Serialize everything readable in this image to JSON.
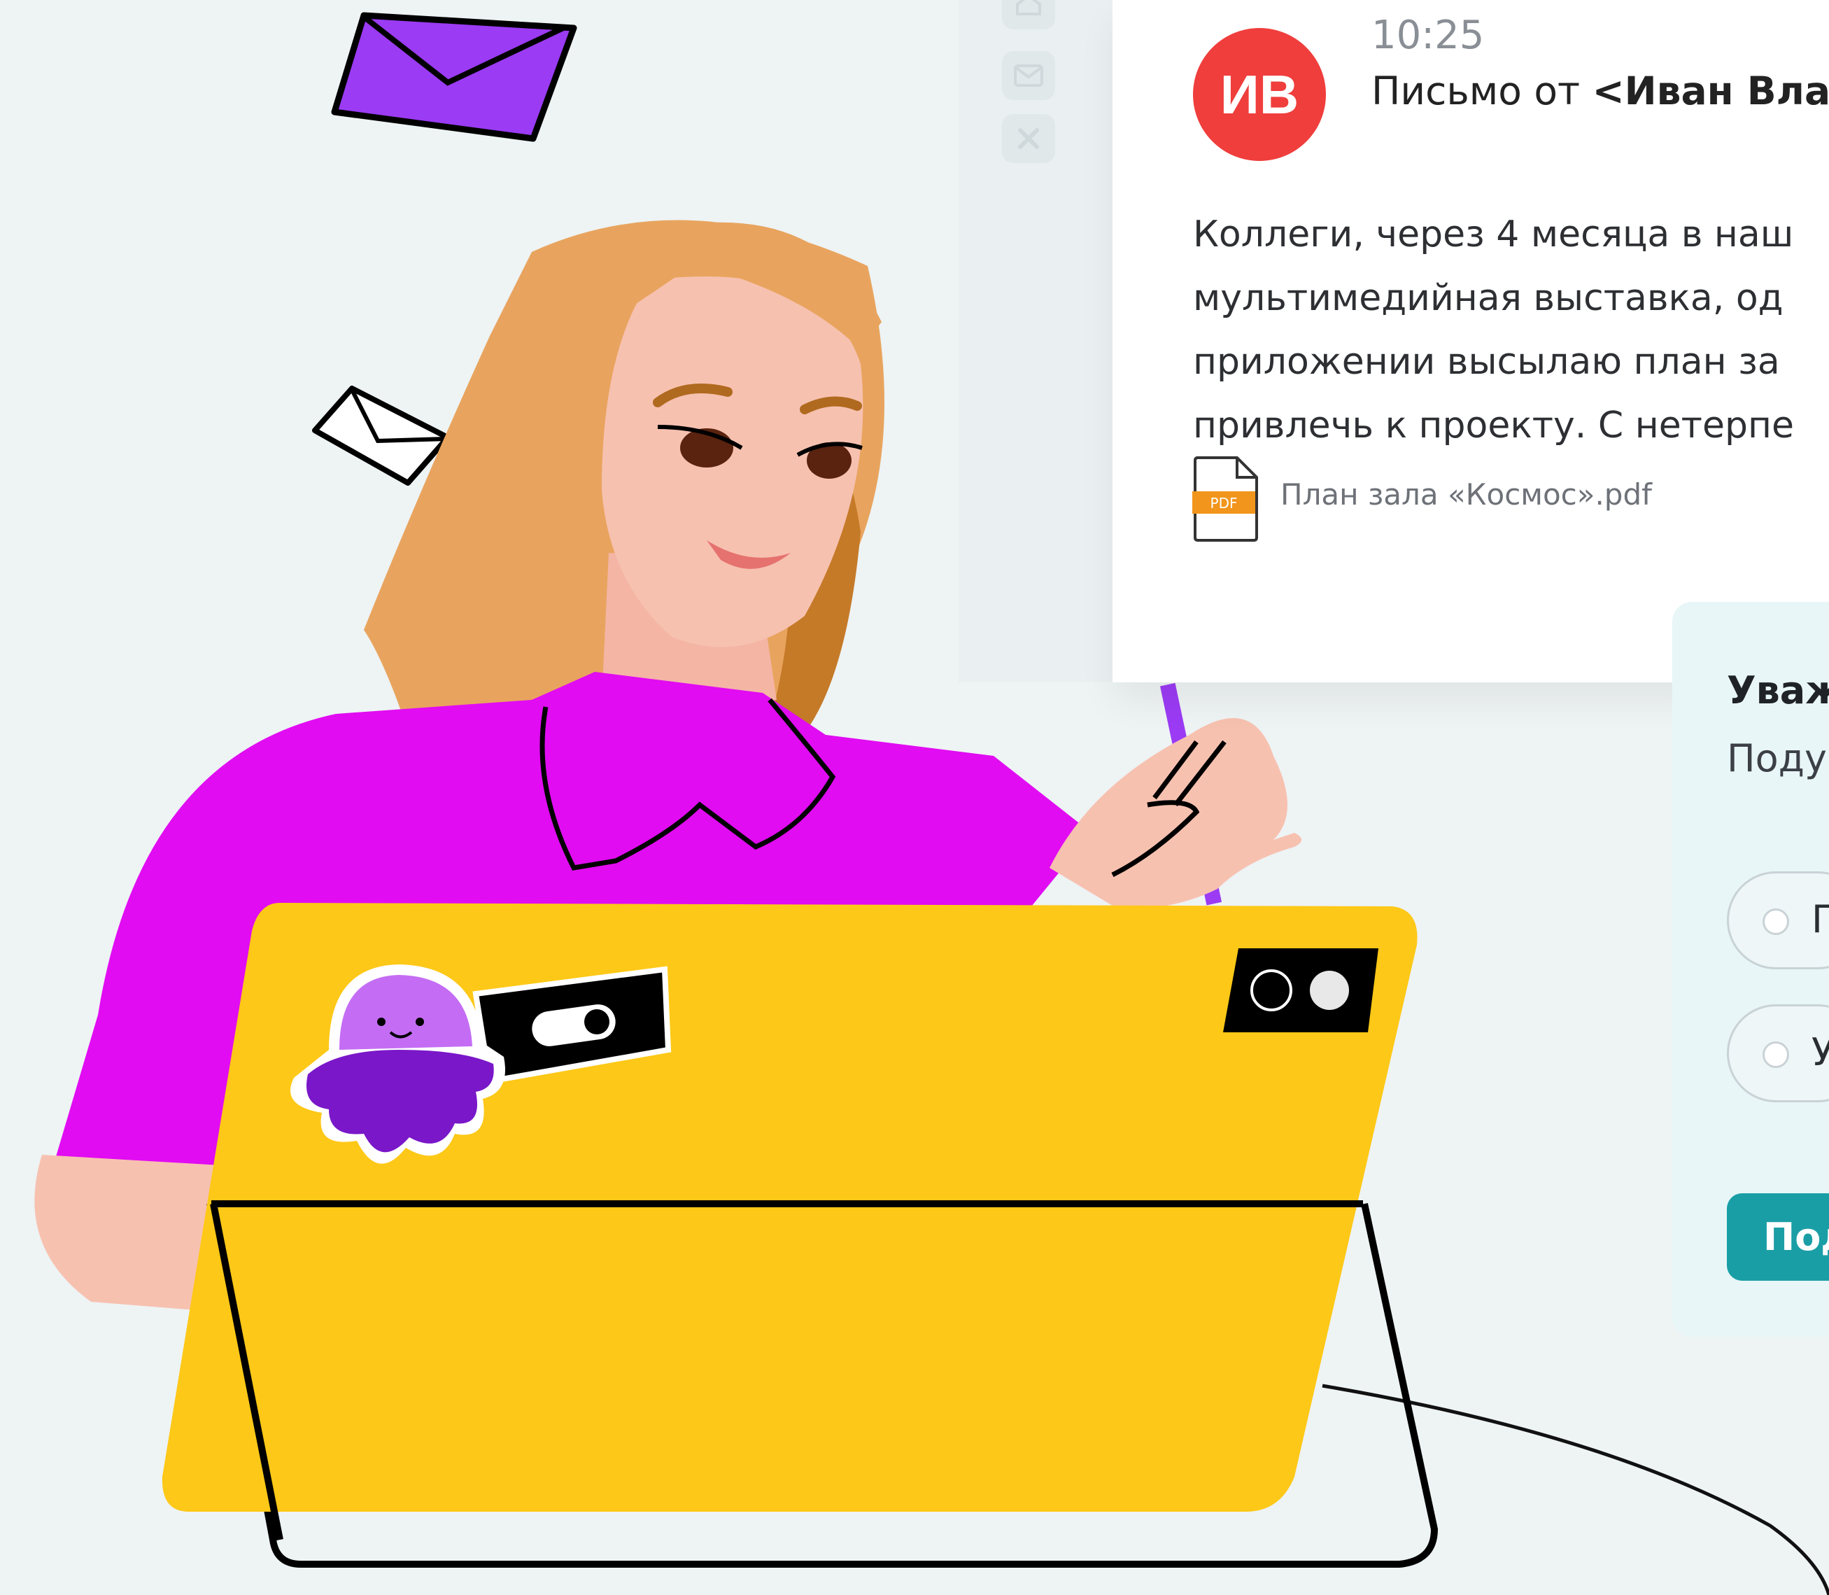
{
  "sidebar": {
    "icons": [
      "home-icon",
      "mail-icon",
      "close-icon"
    ]
  },
  "email": {
    "avatar_initials": "ИВ",
    "time": "10:25",
    "from_prefix": "Письмо от ",
    "from_name": "<Иван Вла",
    "body_lines": [
      "Коллеги, через 4 месяца в наш",
      "мультимедийная выставка, од",
      "приложении высылаю план за",
      "привлечь к проекту. С нетерпе"
    ],
    "attachment": {
      "icon": "pdf-file-icon",
      "badge": "PDF",
      "name": "План зала «Космос».pdf"
    }
  },
  "quiz": {
    "title": "Уваж",
    "subtitle": "Поду",
    "options": [
      {
        "label": "П"
      },
      {
        "label": "У"
      }
    ],
    "submit_label": "Под"
  },
  "colors": {
    "background": "#eef3f4",
    "avatar": "#ef3e3c",
    "accent_button": "#1a9ea6",
    "tablet": "#fdc817",
    "shirt": "#e10cf2",
    "envelope": "#9b3bf4"
  }
}
